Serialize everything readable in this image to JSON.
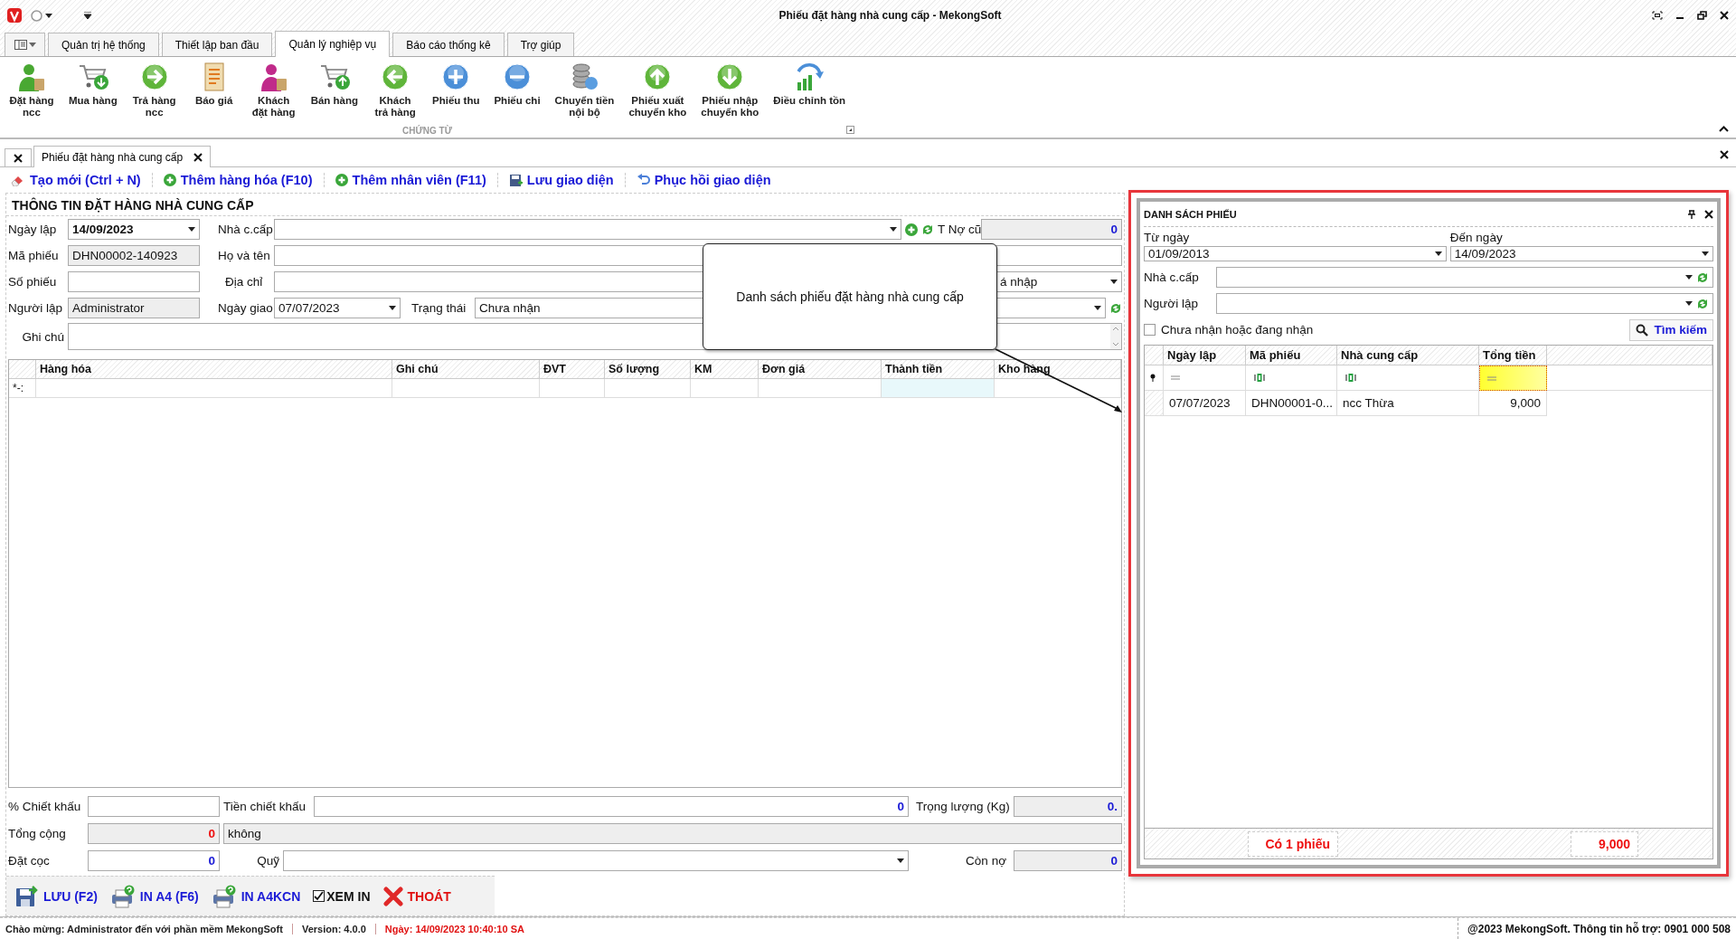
{
  "window": {
    "title": "Phiếu đặt hàng nhà cung cấp - MekongSoft"
  },
  "ribbon": {
    "tabs": [
      {
        "label": "Quản trị hệ thống",
        "selected": false
      },
      {
        "label": "Thiết lập ban đầu",
        "selected": false
      },
      {
        "label": "Quản lý nghiệp vụ",
        "selected": true
      },
      {
        "label": "Báo cáo thống kê",
        "selected": false
      },
      {
        "label": "Trợ giúp",
        "selected": false
      }
    ],
    "items": [
      {
        "label": "Đặt hàng\nncc",
        "kind": "supplier"
      },
      {
        "label": "Mua hàng",
        "kind": "buy"
      },
      {
        "label": "Trả hàng\nncc",
        "kind": "right"
      },
      {
        "label": "Báo giá",
        "kind": "quote"
      },
      {
        "label": "Khách\nđặt hàng",
        "kind": "customer"
      },
      {
        "label": "Bán hàng",
        "kind": "sell"
      },
      {
        "label": "Khách\ntrả hàng",
        "kind": "left"
      },
      {
        "label": "Phiếu thu",
        "kind": "plus"
      },
      {
        "label": "Phiếu chi",
        "kind": "minus"
      },
      {
        "label": "Chuyển tiền\nnội bộ",
        "kind": "coins"
      },
      {
        "label": "Phiếu xuất\nchuyển kho",
        "kind": "up"
      },
      {
        "label": "Phiếu nhập\nchuyển kho",
        "kind": "down"
      },
      {
        "label": "Điều chỉnh tồn",
        "kind": "chart"
      }
    ],
    "group": "CHỨNG TỪ"
  },
  "document_tabs": [
    {
      "label": "Phiếu đặt hàng nhà cung cấp",
      "selected": true
    }
  ],
  "toolbar": [
    {
      "label": "Tạo mới (Ctrl + N)",
      "kind": "eraser"
    },
    {
      "label": "Thêm hàng hóa (F10)",
      "kind": "add"
    },
    {
      "label": "Thêm nhân viên (F11)",
      "kind": "add"
    },
    {
      "label": "Lưu giao diện",
      "kind": "save"
    },
    {
      "label": "Phục hồi giao diện",
      "kind": "undo"
    }
  ],
  "form": {
    "title": "THÔNG TIN ĐẶT HÀNG NHÀ CUNG CẤP",
    "order_date": {
      "label": "Ngày lập",
      "value": "14/09/2023"
    },
    "order_code": {
      "label": "Mã phiếu",
      "value": "DHN00002-140923"
    },
    "slip_number": {
      "label": "Số phiếu"
    },
    "creator": {
      "label": "Người lập",
      "value": "Administrator"
    },
    "supplier": {
      "label": "Nhà c.cấp"
    },
    "old_debt": {
      "label": "T Nợ cũ",
      "value": "0"
    },
    "full_name": {
      "label": "Họ và tên"
    },
    "address": {
      "label": "Địa chỉ"
    },
    "address_type": {
      "value": "á nhập"
    },
    "delivery_date": {
      "label": "Ngày giao",
      "value": "07/07/2023"
    },
    "status": {
      "label": "Trạng thái",
      "value": "Chưa nhận"
    },
    "note": {
      "label": "Ghi chú"
    }
  },
  "grid": {
    "columns": [
      "Hàng hóa",
      "Ghi chú",
      "ĐVT",
      "Số lượng",
      "KM",
      "Đơn giá",
      "Thành tiền",
      "Kho hàng"
    ],
    "new_row_marker": "*-:"
  },
  "totals": {
    "discount_percent": {
      "label": "% Chiết khấu"
    },
    "discount_amount": {
      "label": "Tiền chiết khấu",
      "value": "0"
    },
    "weight": {
      "label": "Trọng lượng (Kg)",
      "value": "0."
    },
    "total": {
      "label": "Tổng cộng",
      "value": "0"
    },
    "total_words": {
      "value": "không"
    },
    "deposit": {
      "label": "Đặt cọc",
      "value": "0"
    },
    "fund": {
      "label": "Quỹ"
    },
    "remaining": {
      "label": "Còn nợ",
      "value": "0"
    }
  },
  "actions": [
    {
      "label": "LƯU (F2)",
      "kind": "save"
    },
    {
      "label": "IN A4 (F6)",
      "kind": "print"
    },
    {
      "label": "IN A4KCN",
      "kind": "print"
    },
    {
      "label": "XEM IN",
      "kind": "check",
      "checked": true
    },
    {
      "label": "THOÁT",
      "kind": "exit"
    }
  ],
  "callout": {
    "text": "Danh sách phiếu đặt hàng nhà cung cấp"
  },
  "list_panel": {
    "title": "DANH SÁCH PHIẾU",
    "from_date": {
      "label": "Từ ngày",
      "value": "01/09/2013"
    },
    "to_date": {
      "label": "Đến ngày",
      "value": "14/09/2023"
    },
    "supplier": {
      "label": "Nhà c.cấp"
    },
    "creator": {
      "label": "Người lập"
    },
    "pending_only": {
      "label": "Chưa nhận hoặc đang nhận",
      "checked": false
    },
    "search_button": "Tìm kiếm",
    "columns": [
      "Ngày lập",
      "Mã phiếu",
      "Nhà cung cấp",
      "Tổng tiền"
    ],
    "filters": [
      {
        "kind": "equals",
        "focused": false
      },
      {
        "kind": "text",
        "focused": false
      },
      {
        "kind": "text",
        "focused": false
      },
      {
        "kind": "equals",
        "focused": true
      }
    ],
    "rows": [
      {
        "cells": [
          "07/07/2023",
          "DHN00001-0...",
          "ncc Thừa",
          "9,000"
        ]
      }
    ],
    "footer": {
      "count": "Có 1 phiếu",
      "total": "9,000"
    }
  },
  "status_bar": {
    "welcome": "Chào mừng: Administrator đến với phần mềm MekongSoft",
    "version": "Version: 4.0.0",
    "date": "Ngày: 14/09/2023 10:40:10 SA",
    "support": "@2023 MekongSoft. Thông tin hỗ trợ: 0901 000 508"
  }
}
